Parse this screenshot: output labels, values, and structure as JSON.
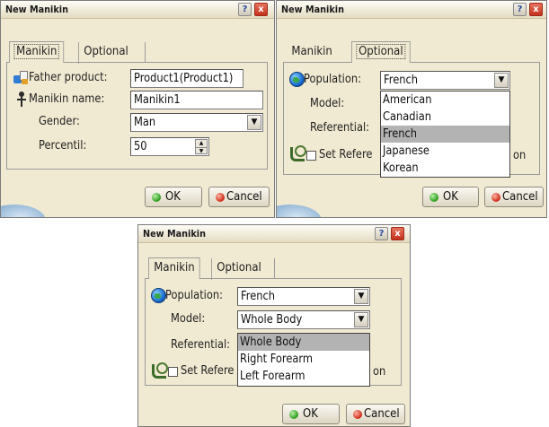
{
  "colors": {
    "dialog_bg": "#f1ead2",
    "selected_option_bg": "#b3b3b3",
    "close_button": "#c4301c",
    "ok_dot": "#2a9a1c",
    "cancel_dot": "#cc2a14"
  },
  "dialog1": {
    "title": "New Manikin",
    "help_label": "?",
    "close_label": "x",
    "tabs": [
      "Manikin",
      "Optional"
    ],
    "active_tab": "Manikin",
    "father_product_label": "Father product:",
    "father_product_value": "Product1(Product1)",
    "manikin_name_label": "Manikin name:",
    "manikin_name_value": "Manikin1",
    "gender_label": "Gender:",
    "gender_value": "Man",
    "percentil_label": "Percentil:",
    "percentil_value": "50",
    "ok_label": "OK",
    "cancel_label": "Cancel"
  },
  "dialog2": {
    "title": "New Manikin",
    "help_label": "?",
    "close_label": "x",
    "tabs": [
      "Manikin",
      "Optional"
    ],
    "active_tab": "Optional",
    "population_label": "Population:",
    "population_value": "French",
    "model_label": "Model:",
    "referential_label": "Referential:",
    "set_reference_label": "Set Refere",
    "set_reference_tail": "on",
    "population_options": [
      "American",
      "Canadian",
      "French",
      "Japanese",
      "Korean"
    ],
    "selected_option": "French",
    "ok_label": "OK",
    "cancel_label": "Cancel"
  },
  "dialog3": {
    "title": "New Manikin",
    "help_label": "?",
    "close_label": "x",
    "tabs": [
      "Manikin",
      "Optional"
    ],
    "active_tab": "Optional",
    "population_label": "Population:",
    "population_value": "French",
    "model_label": "Model:",
    "model_value": "Whole Body",
    "referential_label": "Referential:",
    "set_reference_label": "Set Refere",
    "set_reference_tail": "on",
    "model_options": [
      "Whole Body",
      "Right Forearm",
      "Left Forearm"
    ],
    "selected_option": "Whole Body",
    "ok_label": "OK",
    "cancel_label": "Cancel"
  },
  "icons": {
    "help": "help-icon",
    "close": "close-icon",
    "population": "globe-icon",
    "father_product": "product-icon",
    "manikin_name": "manikin-icon",
    "set_reference": "referential-icon",
    "dropdown": "chevron-down-icon",
    "spinner": "spinner-icon"
  }
}
